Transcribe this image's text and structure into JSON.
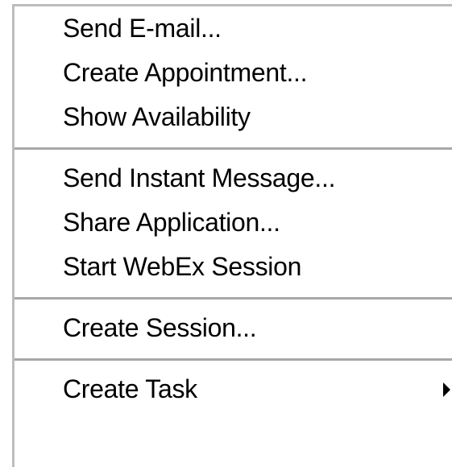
{
  "menu": {
    "groups": [
      {
        "items": [
          {
            "label": "Send E-mail..."
          },
          {
            "label": "Create Appointment..."
          },
          {
            "label": "Show Availability"
          }
        ]
      },
      {
        "items": [
          {
            "label": "Send Instant Message..."
          },
          {
            "label": "Share Application..."
          },
          {
            "label": "Start WebEx Session"
          }
        ]
      },
      {
        "items": [
          {
            "label": "Create Session..."
          }
        ]
      },
      {
        "items": [
          {
            "label": "Create Task",
            "submenu_icon": "triangle-right-icon"
          }
        ]
      }
    ]
  },
  "colors": {
    "background": "#ffffff",
    "text": "#000000",
    "separator": "#a8a8a8",
    "frame_border": "#bdbdbd"
  }
}
